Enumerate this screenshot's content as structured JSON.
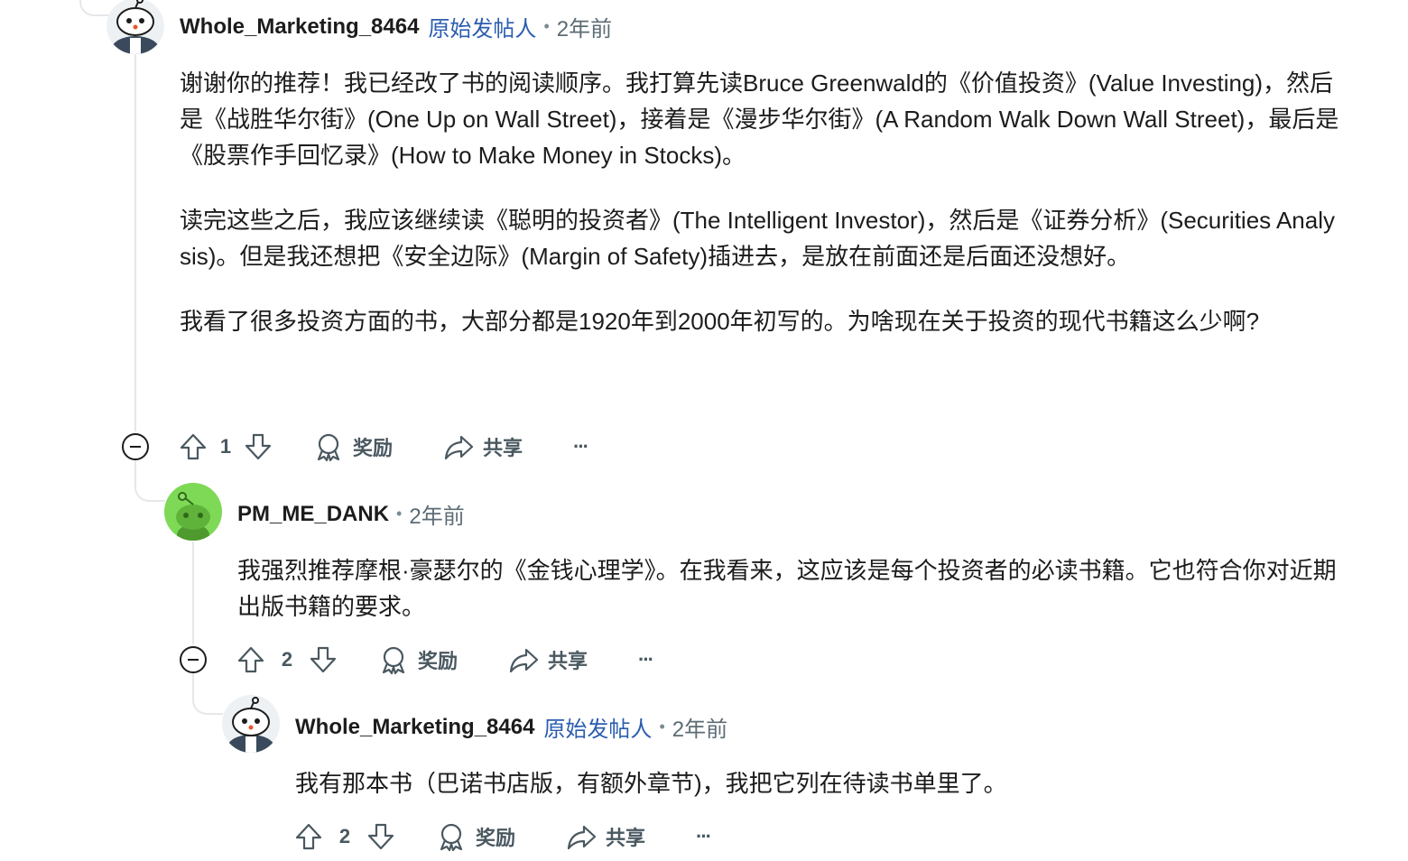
{
  "comments": [
    {
      "author": "Whole_Marketing_8464",
      "op_label": "原始发帖人",
      "separator": "•",
      "time": "2年前",
      "paragraphs": [
        "谢谢你的推荐！我已经改了书的阅读顺序。我打算先读Bruce Greenwald的《价值投资》(Value Investing)，然后是《战胜华尔街》(One Up on Wall Street)，接着是《漫步华尔街》(A Random Walk Down Wall Street)，最后是《股票作手回忆录》(How to Make Money in Stocks)。",
        "读完这些之后，我应该继续读《聪明的投资者》(The Intelligent Investor)，然后是《证券分析》(Securities Analysis)。但是我还想把《安全边际》(Margin of Safety)插进去，是放在前面还是后面还没想好。",
        "我看了很多投资方面的书，大部分都是1920年到2000年初写的。为啥现在关于投资的现代书籍这么少啊?"
      ],
      "votes": "1",
      "award_label": "奖励",
      "share_label": "共享",
      "more_label": "···"
    },
    {
      "author": "PM_ME_DANK",
      "separator": "•",
      "time": "2年前",
      "paragraphs": [
        "我强烈推荐摩根·豪瑟尔的《金钱心理学》。在我看来，这应该是每个投资者的必读书籍。它也符合你对近期出版书籍的要求。"
      ],
      "votes": "2",
      "award_label": "奖励",
      "share_label": "共享",
      "more_label": "···"
    },
    {
      "author": "Whole_Marketing_8464",
      "op_label": "原始发帖人",
      "separator": "•",
      "time": "2年前",
      "paragraphs": [
        "我有那本书（巴诺书店版，有额外章节)，我把它列在待读书单里了。"
      ],
      "votes": "2",
      "award_label": "奖励",
      "share_label": "共享",
      "more_label": "···"
    }
  ],
  "colors": {
    "op_blue": "#2a5db0",
    "thread_line": "#e5e7e9",
    "meta_gray": "#5c6c74",
    "avatar_green": "#7ed957"
  },
  "icons": [
    "snoo-avatar-icon",
    "upvote-icon",
    "downvote-icon",
    "award-icon",
    "share-icon",
    "collapse-icon",
    "more-icon"
  ]
}
